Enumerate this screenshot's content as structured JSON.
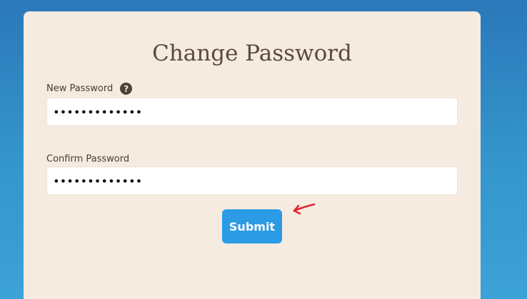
{
  "form": {
    "title": "Change Password",
    "new_password": {
      "label": "New Password",
      "value": "•••••••••••••",
      "help_icon": "question-circle-icon"
    },
    "confirm_password": {
      "label": "Confirm Password",
      "value": "•••••••••••••"
    },
    "submit_label": "Submit"
  },
  "annotation": {
    "arrow_icon": "red-hand-drawn-arrow-icon",
    "arrow_color": "#e0242f"
  },
  "colors": {
    "background_top": "#2b78b9",
    "background_bottom": "#3da2d6",
    "card": "#f5ebe0",
    "submit_button": "#2b9be6",
    "title_text": "#5c4a3b"
  }
}
